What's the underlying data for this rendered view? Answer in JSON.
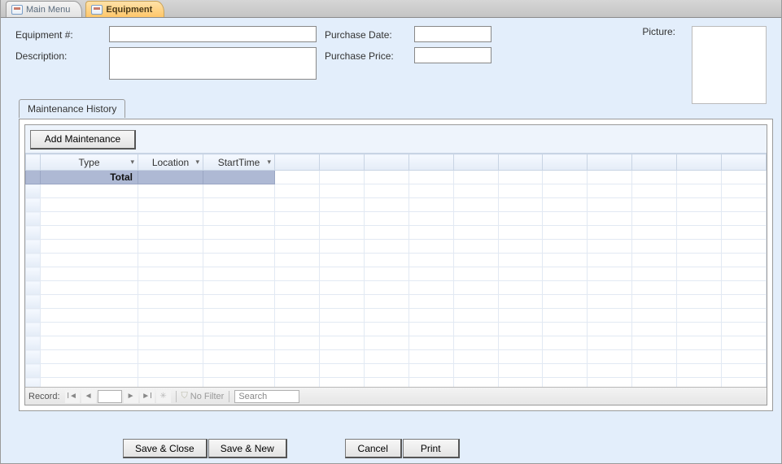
{
  "tabs": {
    "main_menu": "Main Menu",
    "equipment": "Equipment"
  },
  "form": {
    "equipment_num_label": "Equipment #:",
    "equipment_num_value": "",
    "description_label": "Description:",
    "description_value": "",
    "purchase_date_label": "Purchase Date:",
    "purchase_date_value": "",
    "purchase_price_label": "Purchase Price:",
    "purchase_price_value": "",
    "picture_label": "Picture:"
  },
  "subtab": {
    "maintenance_history": "Maintenance History"
  },
  "subform": {
    "add_maintenance": "Add Maintenance",
    "columns": {
      "type": "Type",
      "location": "Location",
      "starttime": "StartTime"
    },
    "total_label": "Total"
  },
  "recnav": {
    "label": "Record:",
    "nofilter": "No Filter",
    "search": "Search"
  },
  "buttons": {
    "save_close": "Save & Close",
    "save_new": "Save & New",
    "cancel": "Cancel",
    "print": "Print"
  }
}
